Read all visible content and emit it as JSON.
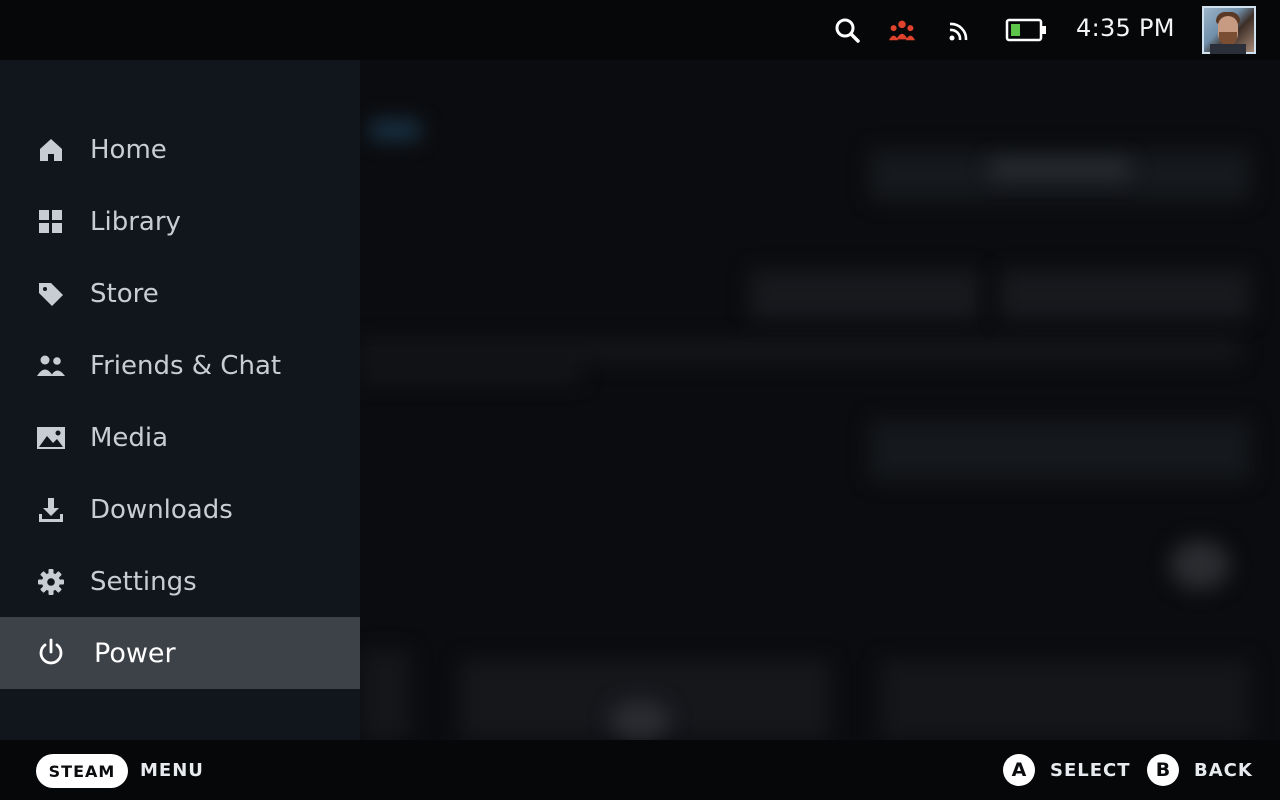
{
  "topbar": {
    "icons": [
      "search-icon",
      "friends-icon",
      "wifi-icon",
      "battery-icon"
    ],
    "clock": "4:35 PM",
    "accent_friends_color": "#e0422d",
    "battery_color": "#5cc54a"
  },
  "menu": {
    "items": [
      {
        "label": "Home",
        "icon": "home-icon"
      },
      {
        "label": "Library",
        "icon": "library-grid-icon"
      },
      {
        "label": "Store",
        "icon": "tag-icon"
      },
      {
        "label": "Friends & Chat",
        "icon": "friends-icon"
      },
      {
        "label": "Media",
        "icon": "image-icon"
      },
      {
        "label": "Downloads",
        "icon": "download-icon"
      },
      {
        "label": "Settings",
        "icon": "gear-icon"
      },
      {
        "label": "Power",
        "icon": "power-icon",
        "selected": true
      }
    ]
  },
  "bottombar": {
    "steam_button": "STEAM",
    "menu_label": "MENU",
    "a_button": "A",
    "select_label": "SELECT",
    "b_button": "B",
    "back_label": "BACK"
  }
}
